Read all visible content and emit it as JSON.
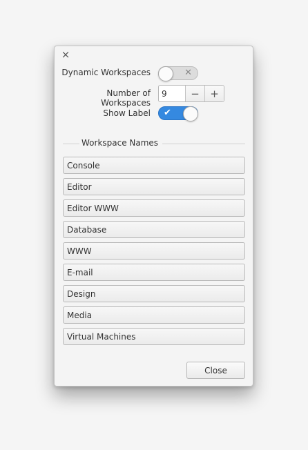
{
  "window": {
    "close_glyph": "×",
    "close_icon": "close-icon"
  },
  "settings": {
    "dynamic_workspaces": {
      "label": "Dynamic Workspaces",
      "enabled": false,
      "off_glyph": "✕"
    },
    "number_of_workspaces": {
      "label": "Number of Workspaces",
      "value": "9",
      "decrement": "−",
      "increment": "+"
    },
    "show_label": {
      "label": "Show Label",
      "enabled": true,
      "on_glyph": "✔"
    }
  },
  "workspace_names": {
    "title": "Workspace Names",
    "items": [
      {
        "value": "Console"
      },
      {
        "value": "Editor"
      },
      {
        "value": "Editor WWW"
      },
      {
        "value": "Database"
      },
      {
        "value": "WWW"
      },
      {
        "value": "E-mail"
      },
      {
        "value": "Design"
      },
      {
        "value": "Media"
      },
      {
        "value": "Virtual Machines"
      }
    ]
  },
  "footer": {
    "close_label": "Close"
  },
  "colors": {
    "accent": "#3589e0",
    "background": "#f4f4f4"
  }
}
